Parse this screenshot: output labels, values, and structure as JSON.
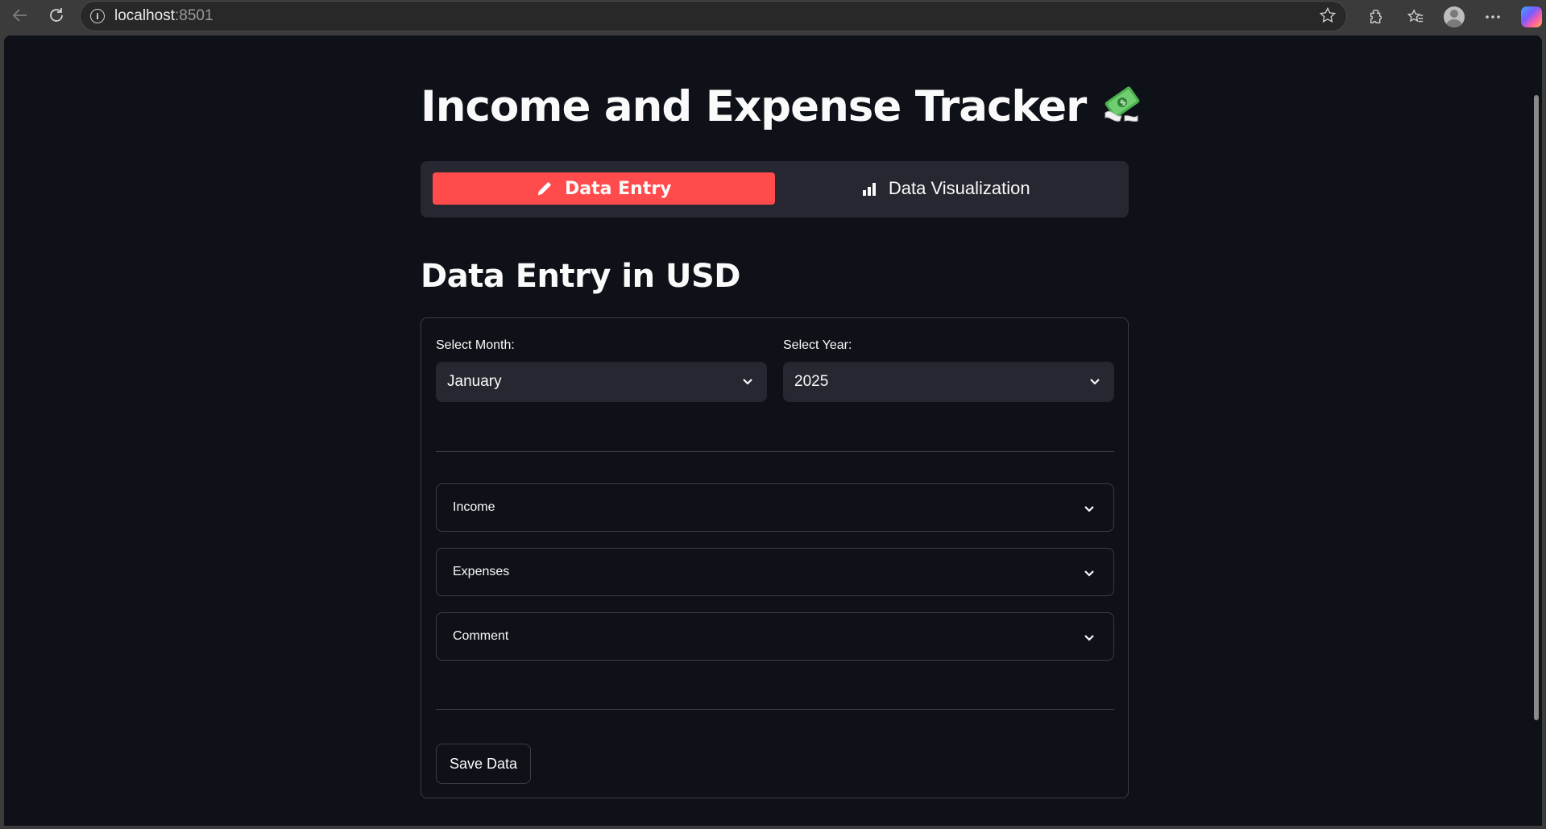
{
  "browser": {
    "url_host": "localhost",
    "url_port": ":8501"
  },
  "app": {
    "title": "Income and Expense Tracker",
    "tabs": [
      {
        "label": "Data Entry",
        "icon": "pencil-icon",
        "active": true
      },
      {
        "label": "Data Visualization",
        "icon": "bar-chart-icon",
        "active": false
      }
    ],
    "section_title": "Data Entry in USD",
    "form": {
      "month_label": "Select Month:",
      "month_value": "January",
      "year_label": "Select Year:",
      "year_value": "2025",
      "expanders": [
        {
          "label": "Income"
        },
        {
          "label": "Expenses"
        },
        {
          "label": "Comment"
        }
      ],
      "save_label": "Save Data"
    }
  },
  "colors": {
    "accent": "#ff4b4b",
    "background": "#0e1117",
    "secondary_bg": "#262730"
  }
}
